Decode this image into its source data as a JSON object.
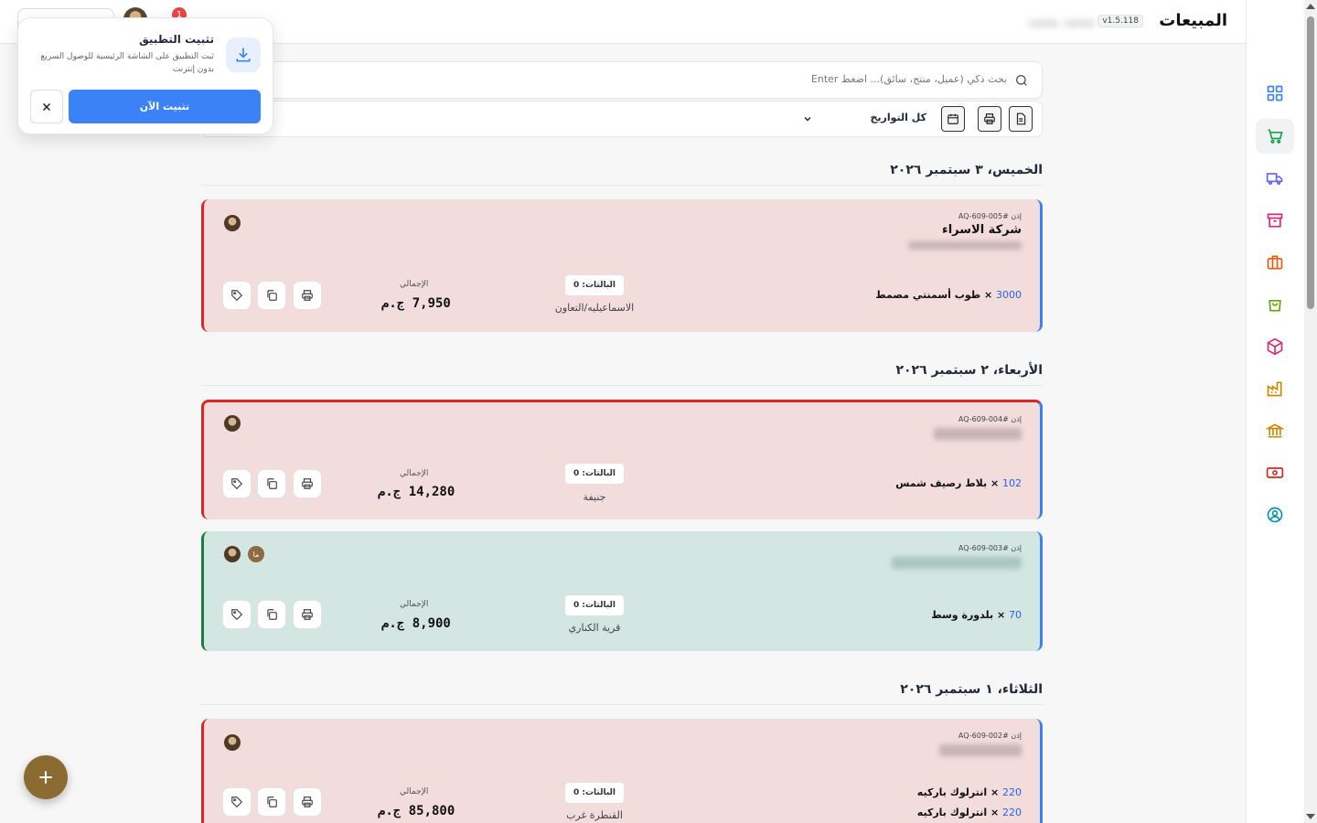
{
  "header": {
    "title": "المبيعات",
    "version": "v1.5.118",
    "user_name": "محمد محمد",
    "notification_count": "1"
  },
  "popup": {
    "title": "تثبيت التطبيق",
    "description": "ثبت التطبيق على الشاشة الرئيسية للوصول السريع بدون إنترنت",
    "install_label": "تثبيت الآن"
  },
  "search": {
    "placeholder": "بحث ذكي (عميل، منتج، سائق)... اضغط Enter"
  },
  "filter": {
    "date_label": "كل التواريخ"
  },
  "days": [
    {
      "label": "الخميس، ٣ سبتمبر ٢٠٢٦"
    },
    {
      "label": "الأربعاء، ٢ سبتمبر ٢٠٢٦"
    },
    {
      "label": "الثلاثاء، ١ سبتمبر ٢٠٢٦"
    }
  ],
  "orders": [
    {
      "id": "إذن #AQ-609-005",
      "client": "شركة الاسراء",
      "items": [
        {
          "qty": "3000",
          "name": "طوب أسمنتي مصمط"
        }
      ],
      "pallets": "البالتات: 0",
      "location": "الاسماعيليه/التعاون",
      "total_label": "الإجمالي",
      "total": "7,950 ج.م",
      "status_color": "#dc2626"
    },
    {
      "id": "إذن #AQ-609-004",
      "client": "",
      "items": [
        {
          "qty": "102",
          "name": "بلاط رصيف شمس"
        }
      ],
      "pallets": "البالتات: 0",
      "location": "جنيفة",
      "total_label": "الإجمالي",
      "total": "14,280 ج.م",
      "status_color": "#dc2626"
    },
    {
      "id": "إذن #AQ-609-003",
      "client": "",
      "items": [
        {
          "qty": "70",
          "name": "بلدورة وسط"
        }
      ],
      "pallets": "البالتات: 0",
      "location": "قرية الكناري",
      "total_label": "الإجمالي",
      "total": "8,900 ج.م",
      "status_color": "#15803d",
      "assignee_initial": "ما"
    },
    {
      "id": "إذن #AQ-609-002",
      "client": "",
      "items": [
        {
          "qty": "220",
          "name": "انترلوك باركيه"
        },
        {
          "qty": "220",
          "name": "انترلوك باركيه"
        }
      ],
      "pallets": "البالتات: 0",
      "location": "القنطرة غرب",
      "total_label": "الإجمالي",
      "total": "85,800 ج.م",
      "status_color": "#dc2626"
    }
  ],
  "sidebar": {
    "icons": [
      {
        "name": "dashboard-icon",
        "color": "#3b82f6"
      },
      {
        "name": "cart-icon",
        "color": "#16a34a"
      },
      {
        "name": "truck-icon",
        "color": "#6366f1"
      },
      {
        "name": "archive-icon",
        "color": "#db2777"
      },
      {
        "name": "briefcase-icon",
        "color": "#ea580c"
      },
      {
        "name": "shopping-bag-icon",
        "color": "#65a30d"
      },
      {
        "name": "box-icon",
        "color": "#db2777"
      },
      {
        "name": "factory-icon",
        "color": "#ca8a04"
      },
      {
        "name": "bank-icon",
        "color": "#ca8a04"
      },
      {
        "name": "cash-icon",
        "color": "#dc2626"
      },
      {
        "name": "user-circle-icon",
        "color": "#0891b2"
      }
    ]
  }
}
